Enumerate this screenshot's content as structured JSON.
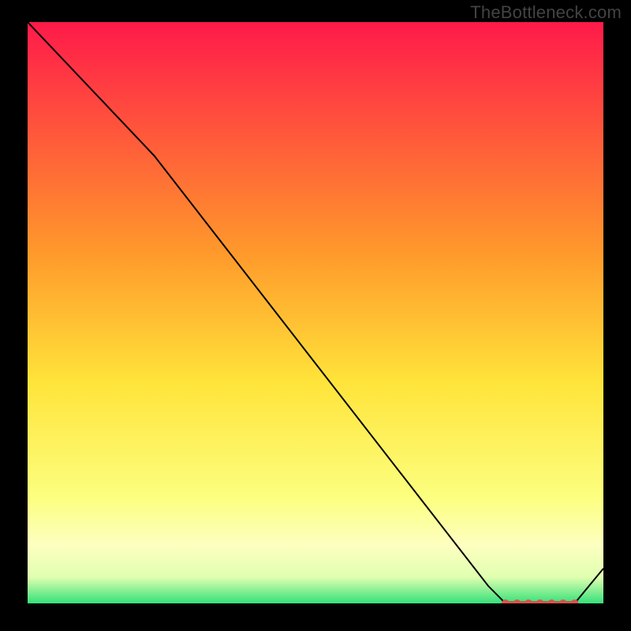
{
  "watermark": "TheBottleneck.com",
  "chart_data": {
    "type": "line",
    "title": "",
    "xlabel": "",
    "ylabel": "",
    "xlim": [
      0,
      100
    ],
    "ylim": [
      0,
      100
    ],
    "grid": false,
    "series": [
      {
        "name": "main-curve",
        "color": "#000000",
        "x": [
          0,
          22,
          80,
          83,
          95,
          100
        ],
        "values": [
          100,
          77,
          3,
          0,
          0,
          6
        ]
      }
    ],
    "markers": [
      {
        "name": "bottom-cluster",
        "color": "#d5554c",
        "x": [
          83,
          85,
          87,
          89,
          91,
          93,
          95
        ],
        "values": [
          0,
          0,
          0,
          0,
          0,
          0,
          0
        ]
      }
    ],
    "annotations": [],
    "legend": []
  },
  "gradient_stops": [
    {
      "offset": 0,
      "color": "#ff1a4a"
    },
    {
      "offset": 0.4,
      "color": "#ff9a2b"
    },
    {
      "offset": 0.62,
      "color": "#ffe43a"
    },
    {
      "offset": 0.82,
      "color": "#fcff80"
    },
    {
      "offset": 0.9,
      "color": "#fdffc0"
    },
    {
      "offset": 0.955,
      "color": "#e0ffb0"
    },
    {
      "offset": 1.0,
      "color": "#35e07a"
    }
  ]
}
